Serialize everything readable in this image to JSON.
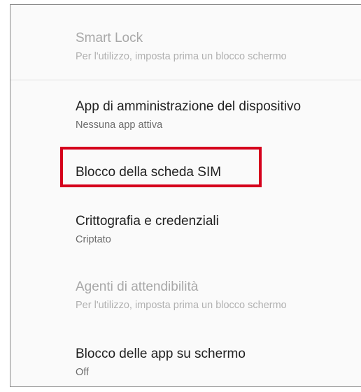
{
  "settings": {
    "items": [
      {
        "title": "Smart Lock",
        "summary": "Per l'utilizzo, imposta prima un blocco schermo",
        "enabled": false
      },
      {
        "title": "App di amministrazione del dispositivo",
        "summary": "Nessuna app attiva",
        "enabled": true
      },
      {
        "title": "Blocco della scheda SIM",
        "summary": "",
        "enabled": true,
        "highlighted": true
      },
      {
        "title": "Crittografia e credenziali",
        "summary": "Criptato",
        "enabled": true
      },
      {
        "title": "Agenti di attendibilità",
        "summary": "Per l'utilizzo, imposta prima un blocco schermo",
        "enabled": false
      },
      {
        "title": "Blocco delle app su schermo",
        "summary": "Off",
        "enabled": true
      }
    ]
  },
  "colors": {
    "highlight": "#d5001c",
    "background": "#fafafa",
    "text_primary": "#212121",
    "text_secondary": "#6b6b6b",
    "text_disabled": "#a8a8a8"
  }
}
